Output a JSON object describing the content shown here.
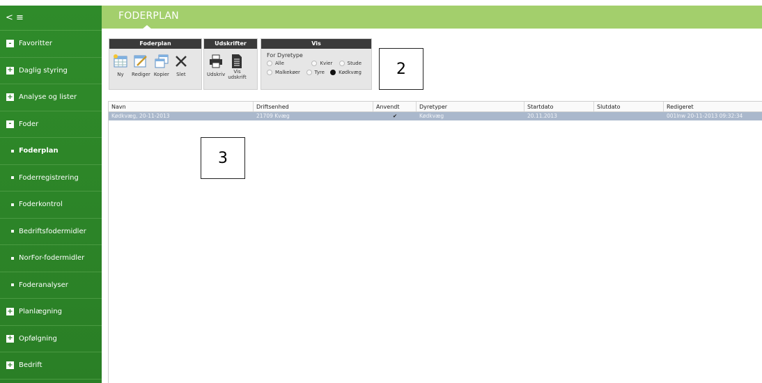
{
  "sidebar": {
    "toggle": "< ≡",
    "items": [
      {
        "label": "Favoritter",
        "kind": "collapse",
        "mark": "-"
      },
      {
        "label": "Daglig styring",
        "kind": "expand",
        "mark": "+"
      },
      {
        "label": "Analyse og lister",
        "kind": "expand",
        "mark": "+"
      },
      {
        "label": "Foder",
        "kind": "collapse",
        "mark": "-"
      },
      {
        "label": "Foderplan",
        "kind": "sub"
      },
      {
        "label": "Foderregistrering",
        "kind": "sub"
      },
      {
        "label": "Foderkontrol",
        "kind": "sub"
      },
      {
        "label": "Bedriftsfodermidler",
        "kind": "sub"
      },
      {
        "label": "NorFor-fodermidler",
        "kind": "sub"
      },
      {
        "label": "Foderanalyser",
        "kind": "sub"
      },
      {
        "label": "Planlægning",
        "kind": "expand",
        "mark": "+"
      },
      {
        "label": "Opfølgning",
        "kind": "expand",
        "mark": "+"
      },
      {
        "label": "Bedrift",
        "kind": "expand",
        "mark": "+"
      }
    ]
  },
  "header": {
    "title": "FODERPLAN"
  },
  "ribbon": {
    "foderplan": {
      "title": "Foderplan",
      "buttons": {
        "ny": "Ny",
        "rediger": "Rediger",
        "kopier": "Kopier",
        "slet": "Slet"
      }
    },
    "udskrifter": {
      "title": "Udskrifter",
      "buttons": {
        "udskriv": "Udskriv",
        "vis_udskrift_1": "Vis",
        "vis_udskrift_2": "udskrift"
      }
    },
    "vis": {
      "title": "Vis",
      "subtitle": "For Dyretype",
      "options": {
        "alle": "Alle",
        "kvier": "Kvier",
        "stude": "Stude",
        "malkekoer": "Malkekøer",
        "tyre": "Tyre",
        "koedkvaeg": "Kødkvæg"
      },
      "selected": "Kødkvæg"
    }
  },
  "callouts": {
    "two": "2",
    "three": "3"
  },
  "table": {
    "columns": {
      "navn": "Navn",
      "driftsenhed": "Driftsenhed",
      "anvendt": "Anvendt",
      "dyretyper": "Dyretyper",
      "startdato": "Startdato",
      "slutdato": "Slutdato",
      "redigeret": "Redigeret"
    },
    "rows": [
      {
        "navn": "Kødkvæg, 20-11-2013",
        "driftsenhed": "21709 Kvæg",
        "anvendt": "✔",
        "dyretyper": "Kødkvæg",
        "startdato": "20.11.2013",
        "slutdato": "",
        "redigeret": "001lnw 20-11-2013 09:32:34"
      }
    ]
  },
  "colors": {
    "sidebar": "#2a7f26",
    "header": "#a3cf6c",
    "selected_row": "#aab8cc"
  }
}
